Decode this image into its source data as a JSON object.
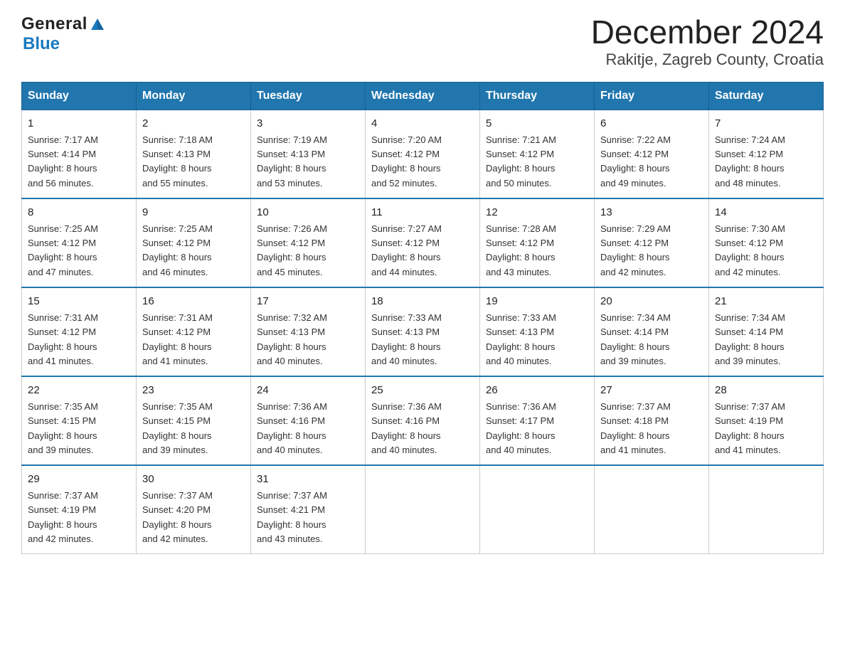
{
  "header": {
    "logo_general": "General",
    "logo_blue": "Blue",
    "month_title": "December 2024",
    "location": "Rakitje, Zagreb County, Croatia"
  },
  "days_of_week": [
    "Sunday",
    "Monday",
    "Tuesday",
    "Wednesday",
    "Thursday",
    "Friday",
    "Saturday"
  ],
  "weeks": [
    [
      {
        "day": "1",
        "sunrise": "7:17 AM",
        "sunset": "4:14 PM",
        "daylight": "8 hours and 56 minutes."
      },
      {
        "day": "2",
        "sunrise": "7:18 AM",
        "sunset": "4:13 PM",
        "daylight": "8 hours and 55 minutes."
      },
      {
        "day": "3",
        "sunrise": "7:19 AM",
        "sunset": "4:13 PM",
        "daylight": "8 hours and 53 minutes."
      },
      {
        "day": "4",
        "sunrise": "7:20 AM",
        "sunset": "4:12 PM",
        "daylight": "8 hours and 52 minutes."
      },
      {
        "day": "5",
        "sunrise": "7:21 AM",
        "sunset": "4:12 PM",
        "daylight": "8 hours and 50 minutes."
      },
      {
        "day": "6",
        "sunrise": "7:22 AM",
        "sunset": "4:12 PM",
        "daylight": "8 hours and 49 minutes."
      },
      {
        "day": "7",
        "sunrise": "7:24 AM",
        "sunset": "4:12 PM",
        "daylight": "8 hours and 48 minutes."
      }
    ],
    [
      {
        "day": "8",
        "sunrise": "7:25 AM",
        "sunset": "4:12 PM",
        "daylight": "8 hours and 47 minutes."
      },
      {
        "day": "9",
        "sunrise": "7:25 AM",
        "sunset": "4:12 PM",
        "daylight": "8 hours and 46 minutes."
      },
      {
        "day": "10",
        "sunrise": "7:26 AM",
        "sunset": "4:12 PM",
        "daylight": "8 hours and 45 minutes."
      },
      {
        "day": "11",
        "sunrise": "7:27 AM",
        "sunset": "4:12 PM",
        "daylight": "8 hours and 44 minutes."
      },
      {
        "day": "12",
        "sunrise": "7:28 AM",
        "sunset": "4:12 PM",
        "daylight": "8 hours and 43 minutes."
      },
      {
        "day": "13",
        "sunrise": "7:29 AM",
        "sunset": "4:12 PM",
        "daylight": "8 hours and 42 minutes."
      },
      {
        "day": "14",
        "sunrise": "7:30 AM",
        "sunset": "4:12 PM",
        "daylight": "8 hours and 42 minutes."
      }
    ],
    [
      {
        "day": "15",
        "sunrise": "7:31 AM",
        "sunset": "4:12 PM",
        "daylight": "8 hours and 41 minutes."
      },
      {
        "day": "16",
        "sunrise": "7:31 AM",
        "sunset": "4:12 PM",
        "daylight": "8 hours and 41 minutes."
      },
      {
        "day": "17",
        "sunrise": "7:32 AM",
        "sunset": "4:13 PM",
        "daylight": "8 hours and 40 minutes."
      },
      {
        "day": "18",
        "sunrise": "7:33 AM",
        "sunset": "4:13 PM",
        "daylight": "8 hours and 40 minutes."
      },
      {
        "day": "19",
        "sunrise": "7:33 AM",
        "sunset": "4:13 PM",
        "daylight": "8 hours and 40 minutes."
      },
      {
        "day": "20",
        "sunrise": "7:34 AM",
        "sunset": "4:14 PM",
        "daylight": "8 hours and 39 minutes."
      },
      {
        "day": "21",
        "sunrise": "7:34 AM",
        "sunset": "4:14 PM",
        "daylight": "8 hours and 39 minutes."
      }
    ],
    [
      {
        "day": "22",
        "sunrise": "7:35 AM",
        "sunset": "4:15 PM",
        "daylight": "8 hours and 39 minutes."
      },
      {
        "day": "23",
        "sunrise": "7:35 AM",
        "sunset": "4:15 PM",
        "daylight": "8 hours and 39 minutes."
      },
      {
        "day": "24",
        "sunrise": "7:36 AM",
        "sunset": "4:16 PM",
        "daylight": "8 hours and 40 minutes."
      },
      {
        "day": "25",
        "sunrise": "7:36 AM",
        "sunset": "4:16 PM",
        "daylight": "8 hours and 40 minutes."
      },
      {
        "day": "26",
        "sunrise": "7:36 AM",
        "sunset": "4:17 PM",
        "daylight": "8 hours and 40 minutes."
      },
      {
        "day": "27",
        "sunrise": "7:37 AM",
        "sunset": "4:18 PM",
        "daylight": "8 hours and 41 minutes."
      },
      {
        "day": "28",
        "sunrise": "7:37 AM",
        "sunset": "4:19 PM",
        "daylight": "8 hours and 41 minutes."
      }
    ],
    [
      {
        "day": "29",
        "sunrise": "7:37 AM",
        "sunset": "4:19 PM",
        "daylight": "8 hours and 42 minutes."
      },
      {
        "day": "30",
        "sunrise": "7:37 AM",
        "sunset": "4:20 PM",
        "daylight": "8 hours and 42 minutes."
      },
      {
        "day": "31",
        "sunrise": "7:37 AM",
        "sunset": "4:21 PM",
        "daylight": "8 hours and 43 minutes."
      },
      null,
      null,
      null,
      null
    ]
  ]
}
